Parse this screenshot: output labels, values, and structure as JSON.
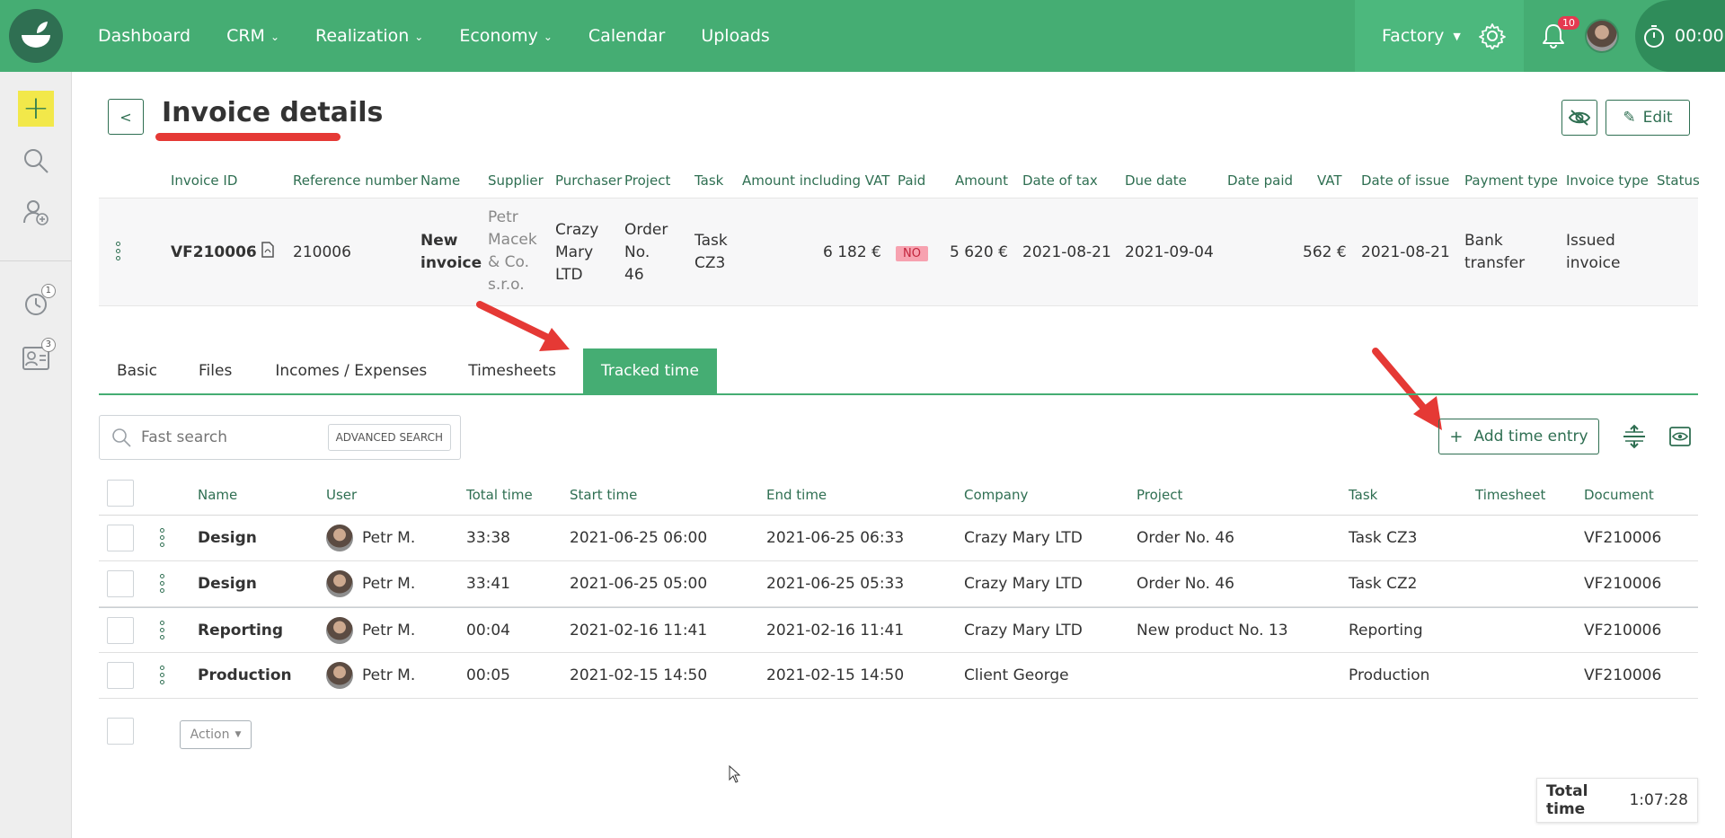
{
  "nav": {
    "items": [
      {
        "label": "Dashboard",
        "dropdown": false
      },
      {
        "label": "CRM",
        "dropdown": true
      },
      {
        "label": "Realization",
        "dropdown": true
      },
      {
        "label": "Economy",
        "dropdown": true
      },
      {
        "label": "Calendar",
        "dropdown": false
      },
      {
        "label": "Uploads",
        "dropdown": false
      }
    ],
    "workspace": "Factory",
    "notification_count": "10",
    "timer": "00:00"
  },
  "sidebar": {
    "reminders_count": "1",
    "contacts_count": "3"
  },
  "page": {
    "title": "Invoice details",
    "edit_label": "Edit"
  },
  "invoice": {
    "headers": [
      "Invoice ID",
      "Reference number",
      "Name",
      "Supplier",
      "Purchaser",
      "Project",
      "Task",
      "Amount including VAT",
      "Paid",
      "Amount",
      "Date of tax",
      "Due date",
      "Date paid",
      "VAT",
      "Date of issue",
      "Payment type",
      "Invoice type",
      "Status"
    ],
    "row": {
      "invoice_id": "VF210006",
      "reference": "210006",
      "name_lines": [
        "New",
        "invoice"
      ],
      "supplier_lines": [
        "Petr",
        "Macek",
        "& Co.",
        "s.r.o."
      ],
      "purchaser_lines": [
        "Crazy",
        "Mary",
        "LTD"
      ],
      "project_lines": [
        "Order",
        "No.",
        "46"
      ],
      "task_lines": [
        "Task",
        "CZ3"
      ],
      "amount_incl_vat": "6 182 €",
      "paid": "NO",
      "amount": "5 620 €",
      "date_of_tax": "2021-08-21",
      "due_date": "2021-09-04",
      "date_paid": "",
      "vat": "562 €",
      "date_of_issue": "2021-08-21",
      "payment_type_lines": [
        "Bank",
        "transfer"
      ],
      "invoice_type_lines": [
        "Issued",
        "invoice"
      ],
      "status": ""
    }
  },
  "tabs": [
    {
      "label": "Basic",
      "active": false
    },
    {
      "label": "Files",
      "active": false
    },
    {
      "label": "Incomes / Expenses",
      "active": false
    },
    {
      "label": "Timesheets",
      "active": false
    },
    {
      "label": "Tracked time",
      "active": true
    }
  ],
  "search": {
    "placeholder": "Fast search",
    "advanced_label": "ADVANCED SEARCH"
  },
  "add_time_entry_label": "Add time entry",
  "time_entries": {
    "headers": [
      "Name",
      "User",
      "Total time",
      "Start time",
      "End time",
      "Company",
      "Project",
      "Task",
      "Timesheet",
      "Document"
    ],
    "rows": [
      {
        "name": "Design",
        "user": "Petr M.",
        "total": "33:38",
        "start": "2021-06-25 06:00",
        "end": "2021-06-25 06:33",
        "company": "Crazy Mary LTD",
        "project": "Order No. 46",
        "task": "Task CZ3",
        "timesheet": "",
        "document": "VF210006"
      },
      {
        "name": "Design",
        "user": "Petr M.",
        "total": "33:41",
        "start": "2021-06-25 05:00",
        "end": "2021-06-25 05:33",
        "company": "Crazy Mary LTD",
        "project": "Order No. 46",
        "task": "Task CZ2",
        "timesheet": "",
        "document": "VF210006"
      },
      {
        "name": "Reporting",
        "user": "Petr M.",
        "total": "00:04",
        "start": "2021-02-16 11:41",
        "end": "2021-02-16 11:41",
        "company": "Crazy Mary LTD",
        "project": "New product No. 13",
        "task": "Reporting",
        "timesheet": "",
        "document": "VF210006"
      },
      {
        "name": "Production",
        "user": "Petr M.",
        "total": "00:05",
        "start": "2021-02-15 14:50",
        "end": "2021-02-15 14:50",
        "company": "Client George",
        "project": "",
        "task": "Production",
        "timesheet": "",
        "document": "VF210006"
      }
    ]
  },
  "action_label": "Action",
  "total": {
    "label": "Total time",
    "value": "1:07:28"
  },
  "colors": {
    "brand_green": "#45ad73",
    "dark_green": "#2f6f52",
    "annotation_red": "#e53935",
    "add_yellow": "#f2e84a"
  }
}
